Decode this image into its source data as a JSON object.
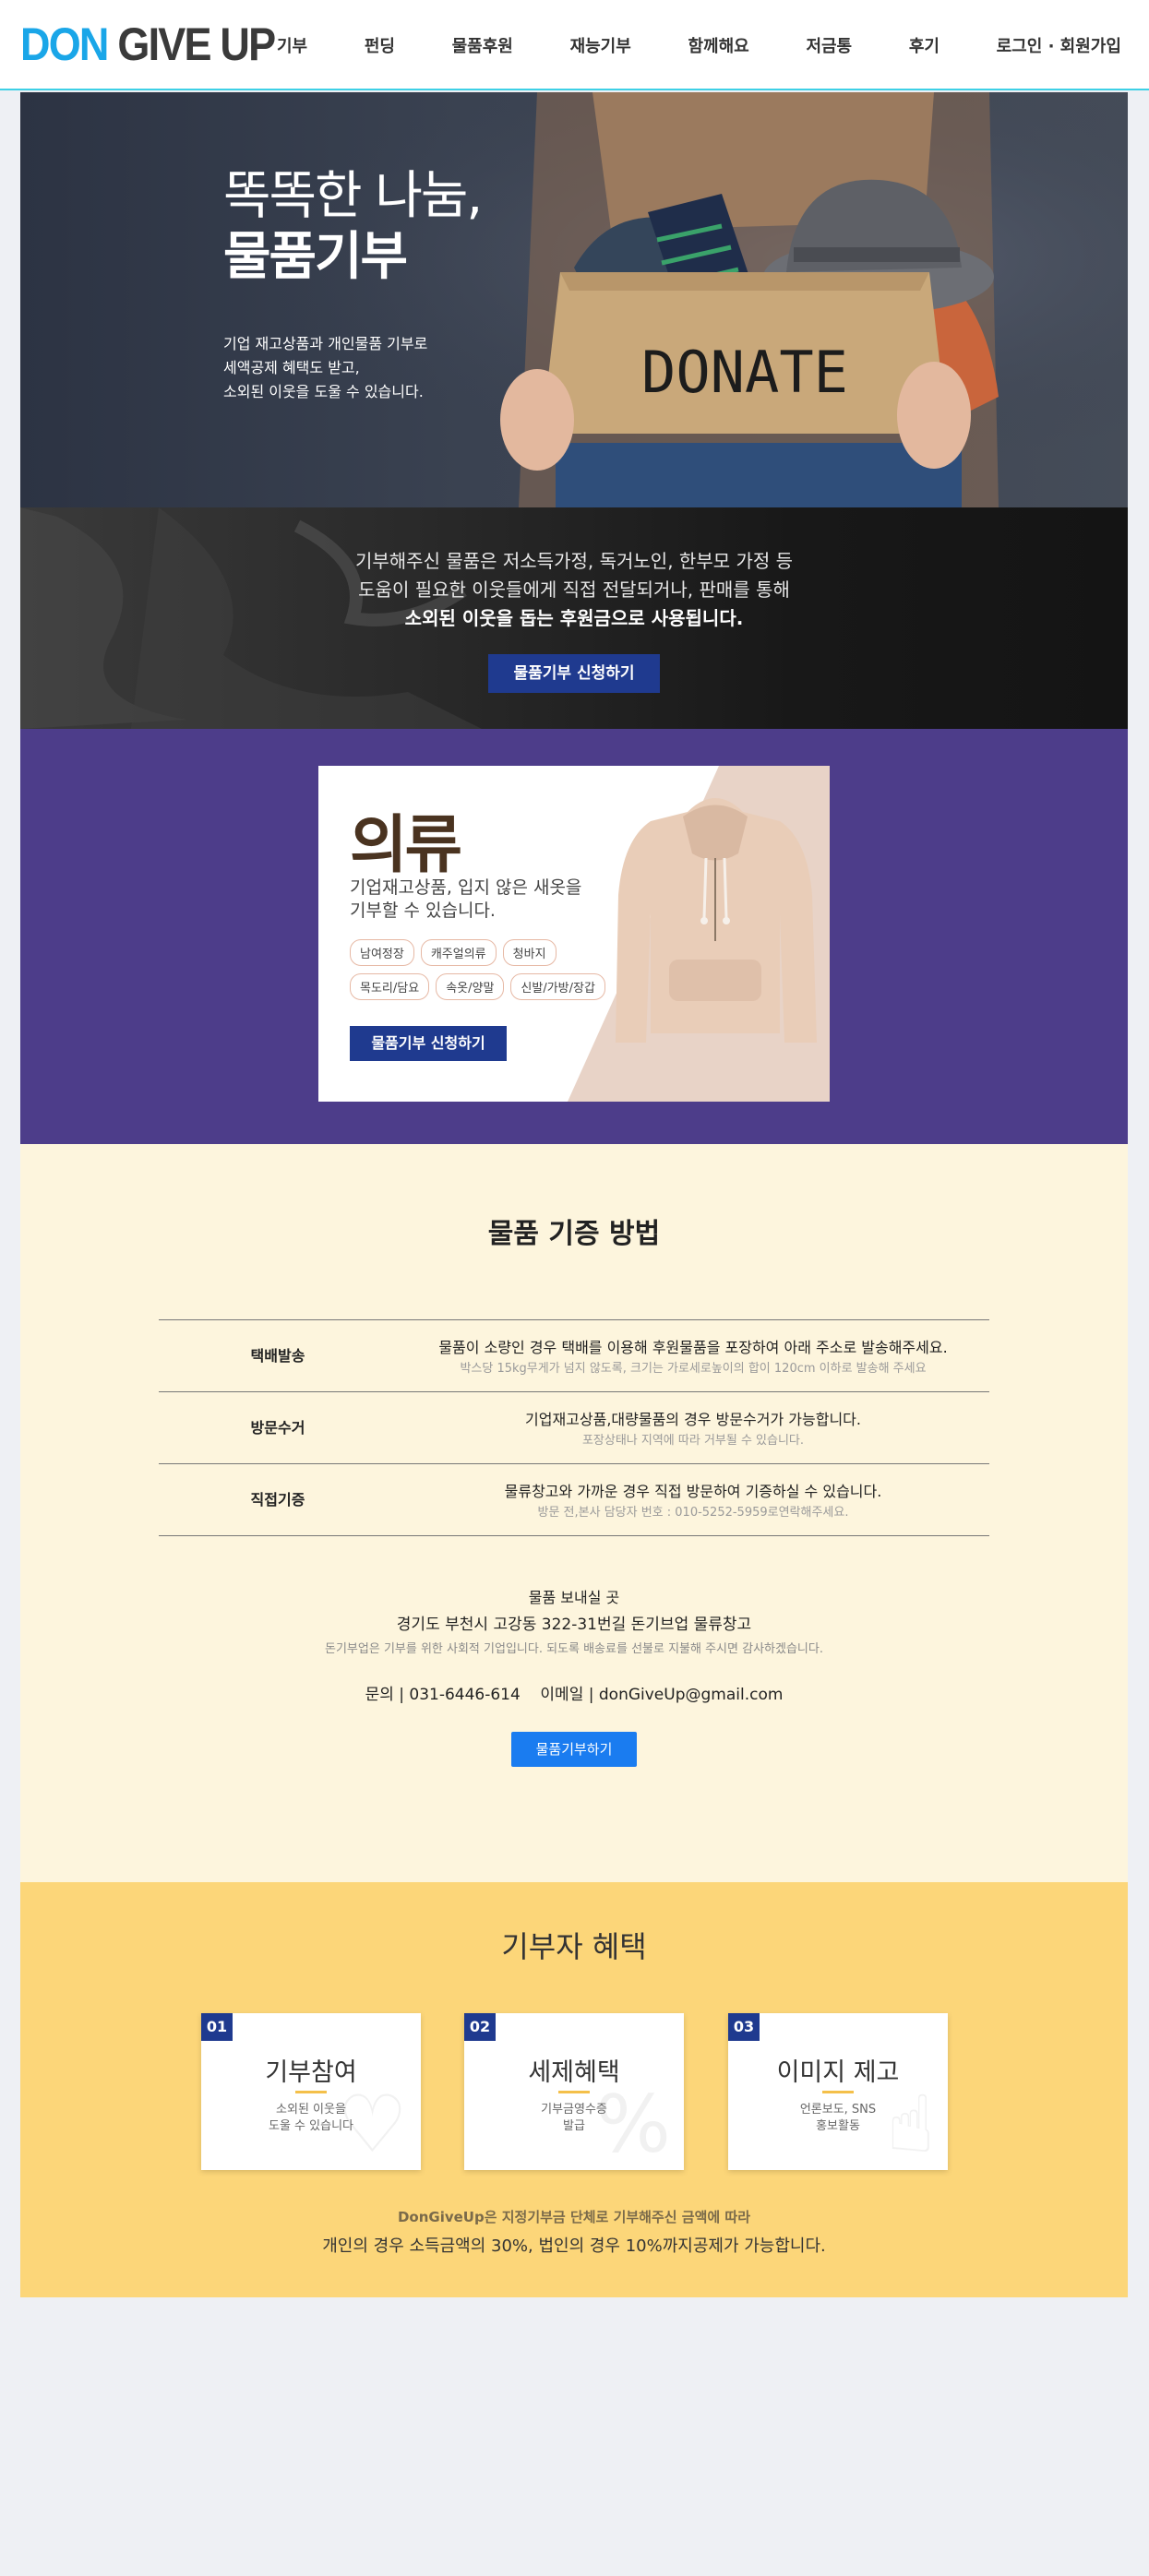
{
  "header": {
    "logo_part1": "DON",
    "logo_part2": "GIVE UP",
    "nav": [
      "기부",
      "펀딩",
      "물품후원",
      "재능기부",
      "함께해요",
      "저금통",
      "후기",
      "로그인 · 회원가입"
    ]
  },
  "hero": {
    "title_line1": "똑똑한 나눔,",
    "title_line2": "물품기부",
    "desc_line1": "기업 재고상품과 개인물품 기부로",
    "desc_line2": "세액공제 혜택도 받고,",
    "desc_line3": "소외된 이웃을 도울 수 있습니다.",
    "box_text": "DONATE"
  },
  "intro": {
    "line1": "기부해주신 물품은 저소득가정, 독거노인, 한부모 가정 등",
    "line2": "도움이 필요한 이웃들에게 직접 전달되거나, 판매를 통해",
    "line3": "소외된 이웃을 돕는 후원금으로 사용됩니다.",
    "button": "물품기부 신청하기"
  },
  "clothing": {
    "title": "의류",
    "desc_line1": "기업재고상품, 입지 않은 새옷을",
    "desc_line2": "기부할 수 있습니다.",
    "tags": [
      "남여정장",
      "캐주얼의류",
      "청바지",
      "목도리/담요",
      "속옷/양말",
      "신발/가방/장갑"
    ],
    "button": "물품기부 신청하기"
  },
  "method": {
    "title": "물품 기증 방법",
    "rows": [
      {
        "label": "택배발송",
        "main": "물품이 소량인 경우 택배를 이용해 후원물품을 포장하여 아래 주소로 발송해주세요.",
        "sub": "박스당 15kg무게가 넘지 않도록, 크기는 가로세로높이의 합이 120cm 이하로 발송해 주세요"
      },
      {
        "label": "방문수거",
        "main": "기업재고상품,대량물품의 경우 방문수거가 가능합니다.",
        "sub": "포장상태나 지역에 따라 거부될 수 있습니다."
      },
      {
        "label": "직접기증",
        "main": "물류창고와 가까운 경우 직접 방문하여 기증하실 수 있습니다.",
        "sub": "방문 전,본사 담당자 번호 : 010-5252-5959로연락해주세요."
      }
    ],
    "address_title": "물품 보내실 곳",
    "address": "경기도 부천시 고강동 322-31번길 돈기브업 물류창고",
    "notice": "돈기부업은 기부를 위한 사회적 기업입니다. 되도록 배송료를 선불로 지불해 주시면 감사하겠습니다.",
    "contact": "문의 | 031-6446-614    이메일 | donGiveUp@gmail.com",
    "button": "물품기부하기"
  },
  "benefit": {
    "title": "기부자 혜택",
    "cards": [
      {
        "num": "01",
        "title": "기부참여",
        "desc_line1": "소외된 이웃을",
        "desc_line2": "도울 수 있습니다",
        "icon": "hand-heart-icon"
      },
      {
        "num": "02",
        "title": "세제혜택",
        "desc_line1": "기부금영수증",
        "desc_line2": "발급",
        "icon": "percent-tag-icon"
      },
      {
        "num": "03",
        "title": "이미지 제고",
        "desc_line1": "언론보도, SNS",
        "desc_line2": "홍보활동",
        "icon": "thumbs-up-icon"
      }
    ],
    "footer_line1": "DonGiveUp은 지정기부금 단체로 기부해주신 금액에 따라",
    "footer_line2": "개인의 경우 소득금액의 30%, 법인의 경우 10%까지공제가 가능합니다."
  },
  "colors": {
    "accent_blue": "#1a7cf0",
    "navy": "#1f3a8f",
    "purple": "#4d3d8a",
    "cream": "#fdf5dd",
    "yellow": "#fcd679",
    "header_line": "#3ed0e6"
  }
}
